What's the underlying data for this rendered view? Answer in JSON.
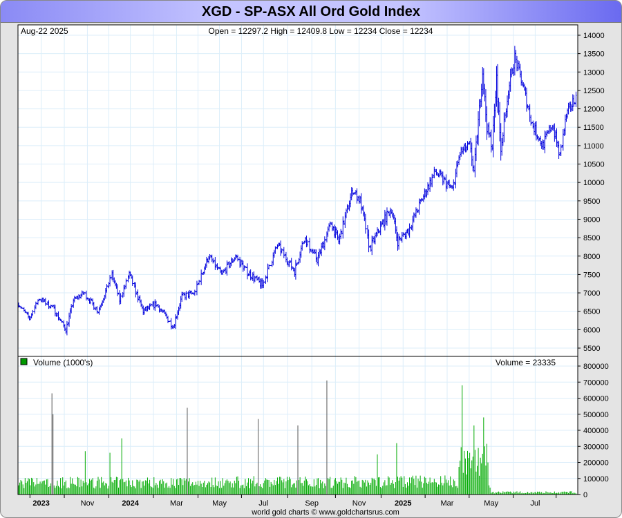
{
  "title": "XGD - SP-ASX All Ord Gold Index",
  "info": {
    "date": "Aug-22  2025",
    "ohlc": "Open = 12297.2   High = 12409.8   Low = 12234   Close = 12234"
  },
  "volume_panel": {
    "legend": "Volume (1000's)",
    "readout": "Volume = 23335",
    "legend_color": "#009900"
  },
  "footer": "world gold charts © www.goldchartsrus.com",
  "chart_data": {
    "type": "ohlc-bar+volume-bar",
    "title": "XGD - SP-ASX All Ord Gold Index",
    "price_ylim": [
      5250,
      14300
    ],
    "price_ticks": [
      5500,
      6000,
      6500,
      7000,
      7500,
      8000,
      8500,
      9000,
      9500,
      10000,
      10500,
      11000,
      11500,
      12000,
      12500,
      13000,
      13500,
      14000
    ],
    "volume_ylim": [
      0,
      800000
    ],
    "volume_ticks": [
      0,
      100000,
      200000,
      300000,
      400000,
      500000,
      600000,
      700000,
      800000
    ],
    "x_ticks": [
      {
        "label": "2023",
        "day": 21,
        "bold": true
      },
      {
        "label": "Nov",
        "day": 64
      },
      {
        "label": "2024",
        "day": 104,
        "bold": true
      },
      {
        "label": "Mar",
        "day": 147
      },
      {
        "label": "May",
        "day": 187
      },
      {
        "label": "Jul",
        "day": 228
      },
      {
        "label": "Sep",
        "day": 273
      },
      {
        "label": "Nov",
        "day": 317
      },
      {
        "label": "2025",
        "day": 358,
        "bold": true
      },
      {
        "label": "Mar",
        "day": 399
      },
      {
        "label": "May",
        "day": 440
      },
      {
        "label": "Jul",
        "day": 481
      }
    ],
    "total_days": 520,
    "price_anchors": [
      [
        0,
        6700
      ],
      [
        10,
        6300
      ],
      [
        19,
        6850
      ],
      [
        32,
        6600
      ],
      [
        44,
        6000
      ],
      [
        51,
        6800
      ],
      [
        61,
        7000
      ],
      [
        74,
        6500
      ],
      [
        87,
        7500
      ],
      [
        94,
        6800
      ],
      [
        103,
        7500
      ],
      [
        116,
        6500
      ],
      [
        128,
        6700
      ],
      [
        144,
        6100
      ],
      [
        152,
        6900
      ],
      [
        164,
        7000
      ],
      [
        177,
        8000
      ],
      [
        189,
        7500
      ],
      [
        202,
        8000
      ],
      [
        212,
        7600
      ],
      [
        227,
        7200
      ],
      [
        241,
        8300
      ],
      [
        257,
        7600
      ],
      [
        266,
        8500
      ],
      [
        278,
        7900
      ],
      [
        291,
        8900
      ],
      [
        298,
        8400
      ],
      [
        311,
        9800
      ],
      [
        318,
        9500
      ],
      [
        327,
        8200
      ],
      [
        337,
        8800
      ],
      [
        347,
        9300
      ],
      [
        353,
        8400
      ],
      [
        363,
        8700
      ],
      [
        375,
        9500
      ],
      [
        388,
        10300
      ],
      [
        404,
        9800
      ],
      [
        411,
        10800
      ],
      [
        420,
        11000
      ],
      [
        424,
        10300
      ],
      [
        432,
        13000
      ],
      [
        436,
        11500
      ],
      [
        441,
        11000
      ],
      [
        445,
        12800
      ],
      [
        449,
        10900
      ],
      [
        456,
        12500
      ],
      [
        462,
        13400
      ],
      [
        469,
        12700
      ],
      [
        478,
        11600
      ],
      [
        488,
        11000
      ],
      [
        497,
        11600
      ],
      [
        504,
        10700
      ],
      [
        510,
        11800
      ],
      [
        518,
        12300
      ]
    ],
    "volume_base": [
      [
        0,
        80000
      ],
      [
        438,
        90000
      ],
      [
        440,
        15000
      ],
      [
        520,
        15000
      ]
    ],
    "volume_spikes": [
      [
        31,
        630000
      ],
      [
        32,
        500000
      ],
      [
        62,
        270000
      ],
      [
        85,
        260000
      ],
      [
        96,
        350000
      ],
      [
        157,
        540000
      ],
      [
        223,
        470000
      ],
      [
        260,
        430000
      ],
      [
        287,
        710000
      ],
      [
        334,
        250000
      ],
      [
        352,
        320000
      ],
      [
        413,
        680000
      ],
      [
        424,
        430000
      ],
      [
        433,
        480000
      ],
      [
        428,
        290000
      ],
      [
        420,
        260000
      ]
    ],
    "last": {
      "open": 12297.2,
      "high": 12409.8,
      "low": 12234,
      "close": 12234,
      "volume": 23335
    }
  }
}
